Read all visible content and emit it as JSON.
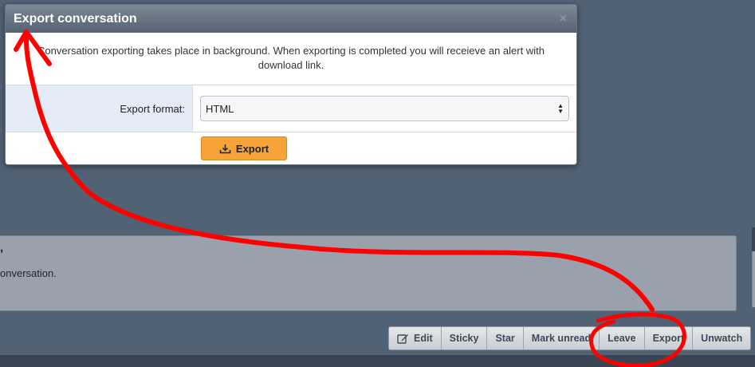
{
  "modal": {
    "title": "Export conversation",
    "close_glyph": "×",
    "description": "Conversation exporting takes place in background. When exporting is completed you will receieve an alert with download link.",
    "format_label": "Export format:",
    "format_value": "HTML",
    "export_button": "Export",
    "export_icon": "download-icon",
    "accent_color": "#f6a33a"
  },
  "message": {
    "greeting": ",",
    "text_fragment": "onversation."
  },
  "actions": {
    "edit_icon": "edit-icon",
    "edit": "Edit",
    "sticky": "Sticky",
    "star": "Star",
    "mark_unread": "Mark unread",
    "leave": "Leave",
    "export": "Export",
    "unwatch": "Unwatch"
  },
  "annotation_color": "#ff0000"
}
